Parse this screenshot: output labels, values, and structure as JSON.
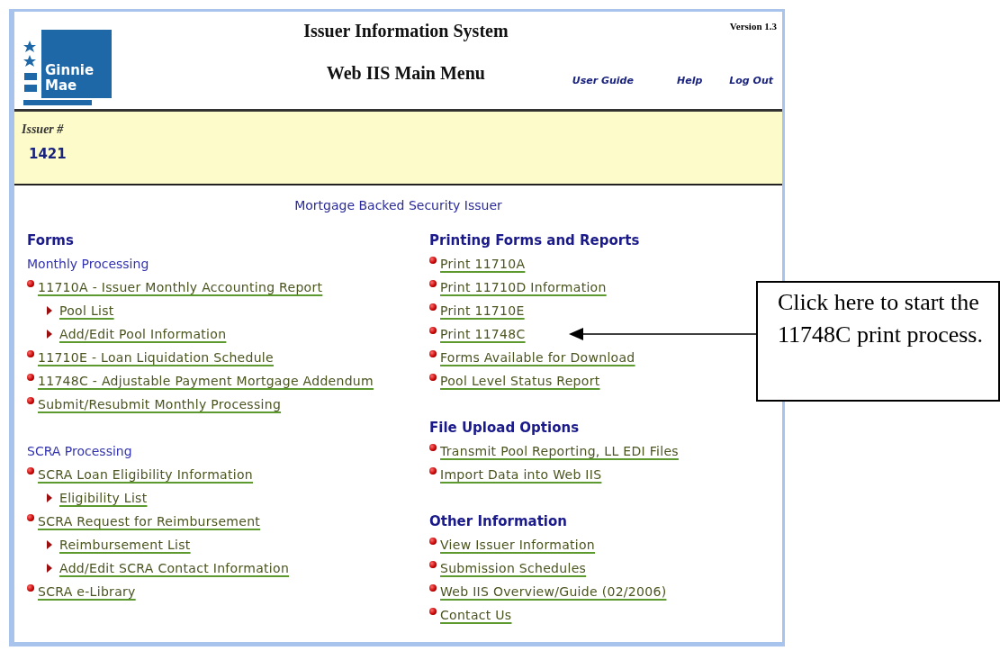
{
  "header": {
    "logo_text": [
      "Ginnie",
      "Mae"
    ],
    "title": "Issuer Information System",
    "subtitle": "Web IIS Main Menu",
    "version": "Version 1.3",
    "links": [
      "User Guide",
      "Help",
      "Log Out"
    ]
  },
  "issuer": {
    "label": "Issuer #",
    "value": "1421"
  },
  "body_title": "Mortgage Backed Security Issuer",
  "columns": [
    [
      {
        "heading": "Forms",
        "subheading": "Monthly Processing",
        "items": [
          {
            "label": "11710A - Issuer Monthly Accounting Report",
            "children": [
              {
                "label": "Pool List"
              },
              {
                "label": "Add/Edit Pool Information"
              }
            ]
          },
          {
            "label": "11710E - Loan Liquidation Schedule"
          },
          {
            "label": "11748C - Adjustable Payment Mortgage Addendum"
          },
          {
            "label": "Submit/Resubmit Monthly Processing"
          }
        ]
      },
      {
        "subheading": "SCRA Processing",
        "items": [
          {
            "label": "SCRA Loan Eligibility Information",
            "children": [
              {
                "label": "Eligibility List"
              }
            ]
          },
          {
            "label": "SCRA Request for Reimbursement",
            "children": [
              {
                "label": "Reimbursement List"
              },
              {
                "label": "Add/Edit SCRA Contact Information"
              }
            ]
          },
          {
            "label": "SCRA e-Library"
          }
        ]
      }
    ],
    [
      {
        "heading": "Printing Forms and Reports",
        "items": [
          {
            "label": "Print 11710A"
          },
          {
            "label": "Print 11710D Information"
          },
          {
            "label": "Print 11710E"
          },
          {
            "label": "Print 11748C"
          },
          {
            "label": "Forms Available for Download"
          },
          {
            "label": "Pool Level Status Report"
          }
        ]
      },
      {
        "heading": "File Upload Options",
        "items": [
          {
            "label": "Transmit Pool Reporting, LL EDI Files"
          },
          {
            "label": "Import Data into Web IIS"
          }
        ]
      },
      {
        "heading": "Other Information",
        "items": [
          {
            "label": "View Issuer Information"
          },
          {
            "label": "Submission Schedules"
          },
          {
            "label": "Web IIS Overview/Guide (02/2006)"
          },
          {
            "label": "Contact Us"
          }
        ]
      }
    ]
  ],
  "callout": {
    "text": "Click here to start the 11748C print process."
  }
}
